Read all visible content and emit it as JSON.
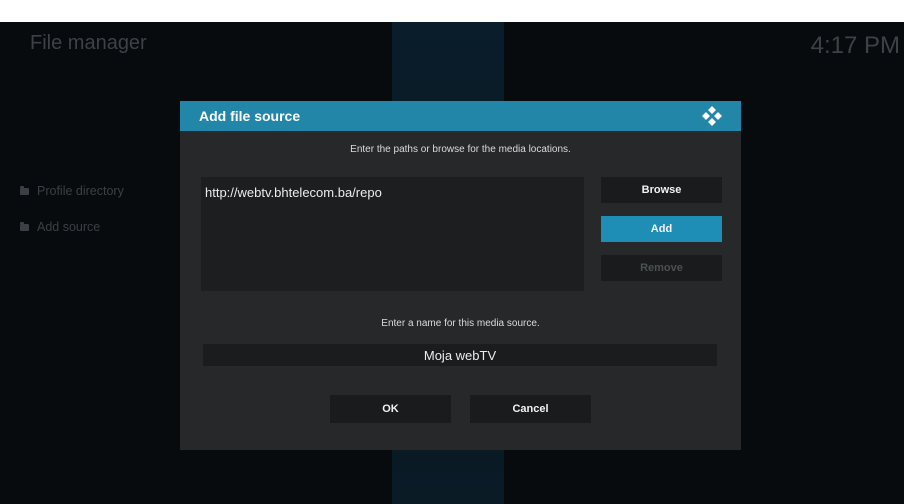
{
  "window": {
    "title": "File manager",
    "clock": "4:17 PM"
  },
  "sidebar": {
    "items": [
      {
        "label": "Profile directory",
        "icon": "folder-icon"
      },
      {
        "label": "Add source",
        "icon": "folder-icon"
      }
    ]
  },
  "dialog": {
    "title": "Add file source",
    "logo": "kodi-logo",
    "paths_prompt": "Enter the paths or browse for the media locations.",
    "paths": [
      "http://webtv.bhtelecom.ba/repo"
    ],
    "buttons": {
      "browse": "Browse",
      "add": "Add",
      "remove": "Remove",
      "ok": "OK",
      "cancel": "Cancel"
    },
    "name_prompt": "Enter a name for this media source.",
    "name_value": "Moja webTV",
    "focused_button": "Add",
    "disabled_buttons": [
      "Remove"
    ]
  },
  "colors": {
    "accent": "#2186a7",
    "focus": "#1e8eb6",
    "background": "#080b0d",
    "dialog": "#26282a"
  }
}
